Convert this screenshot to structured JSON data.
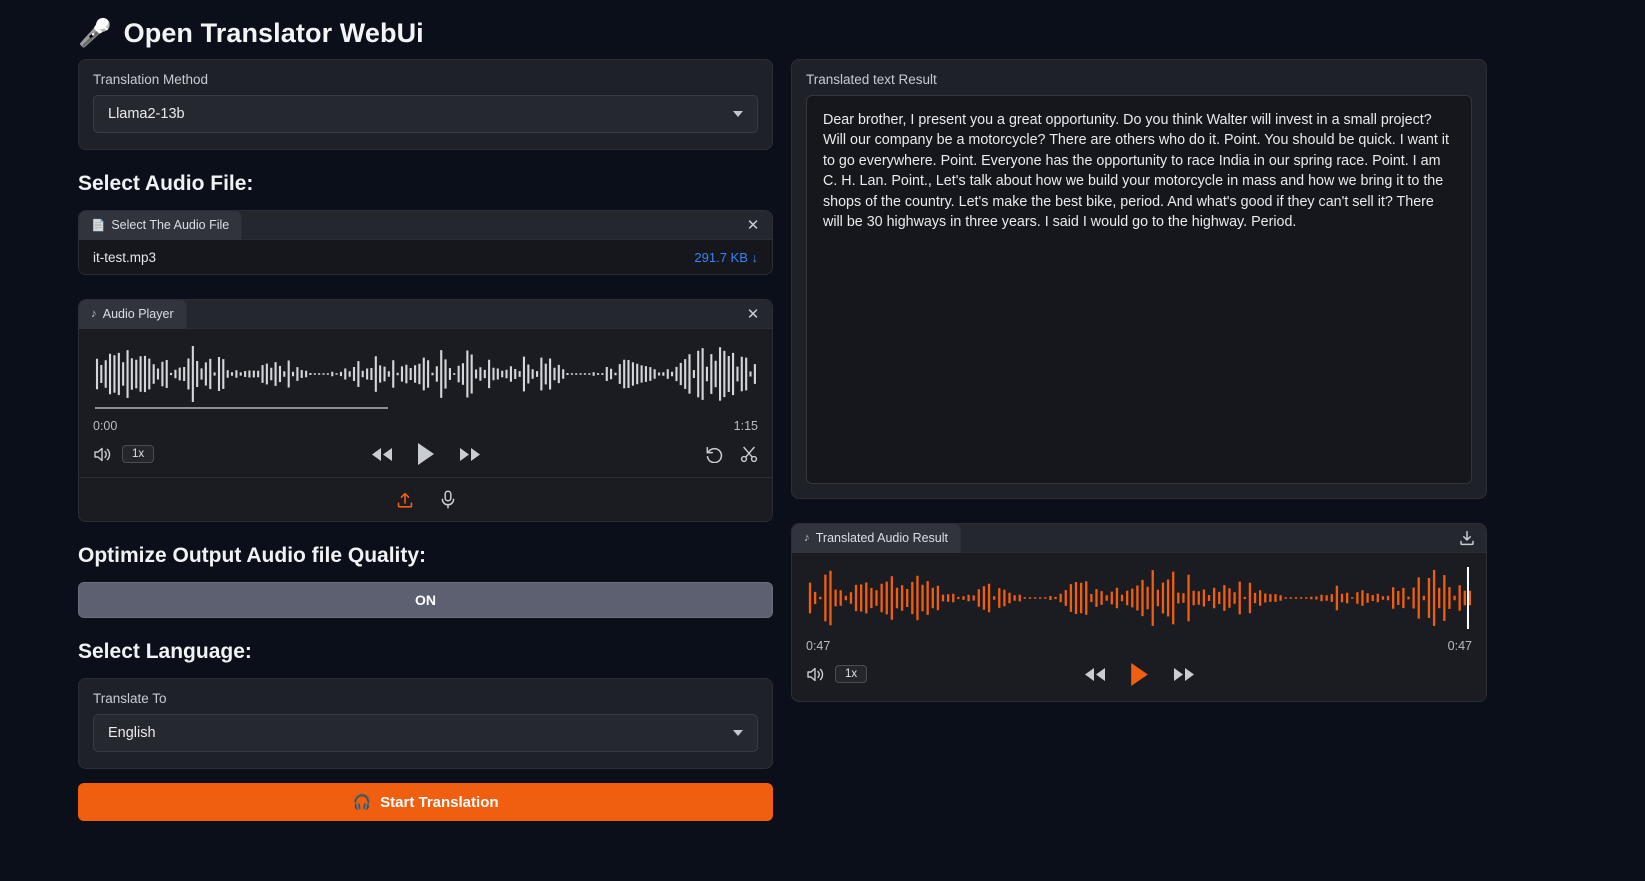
{
  "app": {
    "title": "Open Translator WebUi",
    "mic_icon": "microphone-icon"
  },
  "translation_method": {
    "label": "Translation Method",
    "value": "Llama2-13b"
  },
  "audio_file": {
    "heading": "Select Audio File:",
    "tab_label": "Select The Audio File",
    "file_name": "it-test.mp3",
    "file_size": "291.7 KB ↓",
    "close_label": "✕"
  },
  "audio_player": {
    "tab_label": "Audio Player",
    "close_label": "✕",
    "time_start": "0:00",
    "time_end": "1:15",
    "speed": "1x",
    "volume_icon": "volume-icon",
    "rewind_icon": "rewind-icon",
    "play_icon": "play-icon",
    "forward_icon": "forward-icon",
    "undo_icon": "undo-icon",
    "trim_icon": "scissors-icon",
    "upload_icon": "upload-icon",
    "record_icon": "microphone-icon"
  },
  "optimize": {
    "heading": "Optimize Output Audio file Quality:",
    "state": "ON"
  },
  "language": {
    "heading": "Select Language:",
    "label": "Translate To",
    "value": "English"
  },
  "start": {
    "label": "Start Translation",
    "icon": "headphones-icon"
  },
  "translated_text": {
    "label": "Translated text Result",
    "body": "Dear brother, I present you a great opportunity. Do you think Walter will invest in a small project? Will our company be a motorcycle? There are others who do it. Point. You should be quick. I want it to go everywhere. Point. Everyone has the opportunity to race India in our spring race. Point. I am C. H. Lan. Point., Let's talk about how we build your motorcycle in mass and how we bring it to the shops of the country. Let's make the best bike, period. And what's good if they can't sell it? There will be 30 highways in three years. I said I would go to the highway. Period."
  },
  "translated_audio": {
    "tab_label": "Translated Audio Result",
    "download_icon": "download-icon",
    "time_start": "0:47",
    "time_end": "0:47",
    "speed": "1x",
    "volume_icon": "volume-icon",
    "rewind_icon": "rewind-icon",
    "play_icon": "play-icon",
    "forward_icon": "forward-icon"
  },
  "colors": {
    "accent": "#f05e10",
    "link": "#3b82f6",
    "background": "#0b0f19",
    "panel": "#1f2128",
    "toggle_on": "#5d6070"
  }
}
